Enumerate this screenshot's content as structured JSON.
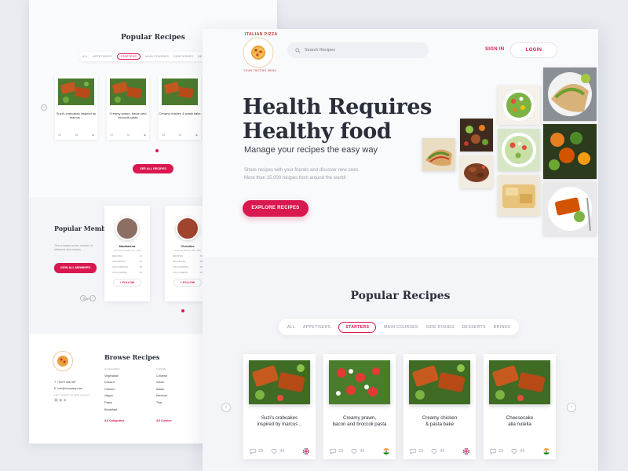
{
  "back_page": {
    "popular_title": "Popular Recipes",
    "tabs": [
      "ALL",
      "APPETISERS",
      "STARTERS",
      "MAIN COURSES",
      "SIDE DISHES",
      "DESSERTS"
    ],
    "cards": [
      {
        "name": "Suzi's crabcakes inspired by marcus ..",
        "comments": "23",
        "likes": "34"
      },
      {
        "name": "Creamy prawn, bacon and broccoli pasta",
        "comments": "23",
        "likes": "34"
      },
      {
        "name": "Creamy chicken & pasta bake",
        "comments": "23",
        "likes": "34"
      }
    ],
    "see_all_label": "SEE ALL RECIPES",
    "members_title": "Popular Members",
    "members_desc": "This is based on the number of followers and recipes",
    "view_all_label": "VIEW ALL MEMBERS",
    "page_of": "2 of 5",
    "members": [
      {
        "name": "Maddalena",
        "location": "Germine Gussit (TV), Italy",
        "recipes": "23",
        "favorites": "25",
        "followings": "56",
        "followers": "20",
        "follow": "+ FOLLOW"
      },
      {
        "name": "Christine",
        "location": "Germine Gussit (TV), Italy",
        "recipes": "23",
        "favorites": "25",
        "followings": "56",
        "followers": "20",
        "follow": "+ FOLLOW"
      }
    ],
    "member_labels": {
      "recipes": "RECIPES",
      "favorites": "FAVORITES",
      "followings": "FOLLOWINGS",
      "followers": "FOLLOWERS"
    },
    "browse_title": "Browse Recipes",
    "categories_header": "CATEGORIES",
    "categories": [
      "Vegetarian",
      "Dessert",
      "Chicken",
      "Vegan",
      "Pasta",
      "Breakfast"
    ],
    "categories_all": "All Categories",
    "cuisine_header": "CUISINE",
    "cuisines": [
      "Chinese",
      "Indian",
      "Italian",
      "Mexican",
      "Thai"
    ],
    "cuisine_all": "All Cuisine",
    "phone": "T: +9574 456 987",
    "email": "E: info@company.com",
    "footer_note": "Latin company, all rights reserved"
  },
  "header": {
    "logo_text": "ITALIAN PIZZA",
    "logo_sub": "YOUR TASTING MENU",
    "search_placeholder": "Search Recipes",
    "sign_in": "SIGN IN",
    "login": "LOGIN"
  },
  "hero": {
    "title_line1": "Health Requires",
    "title_line2": "Healthy food",
    "subtitle": "Manage your recipes the easy way",
    "desc_line1": "Share recipes with your friends and discover new ones.",
    "desc_line2": "More than 15,000 recipes from around the world!",
    "cta": "EXPLORE RECIPES"
  },
  "popular": {
    "title": "Popular Recipes",
    "tabs": [
      "ALL",
      "APPETISERS",
      "STARTERS",
      "MAIN COURSES",
      "SIDE DISHES",
      "DESSERTS",
      "DRINKS"
    ],
    "active_tab": "STARTERS",
    "cards": [
      {
        "line1": "Suzi's crabcakes",
        "line2": "inspired by marcus ..",
        "comments": "23",
        "likes": "34",
        "flag": "uk-flag-icon"
      },
      {
        "line1": "Creamy prawn,",
        "line2": "bacon and broccoli pasta",
        "comments": "23",
        "likes": "34",
        "flag": "india-flag-icon"
      },
      {
        "line1": "Creamy chicken",
        "line2": "& pasta bake",
        "comments": "23",
        "likes": "34",
        "flag": "uk-flag-icon"
      },
      {
        "line1": "Cheesecake",
        "line2": "alla nutella",
        "comments": "23",
        "likes": "34",
        "flag": "india-flag-icon"
      }
    ]
  },
  "colors": {
    "accent": "#d8184f",
    "text": "#2b2f3a",
    "muted": "#9aa0ac"
  }
}
